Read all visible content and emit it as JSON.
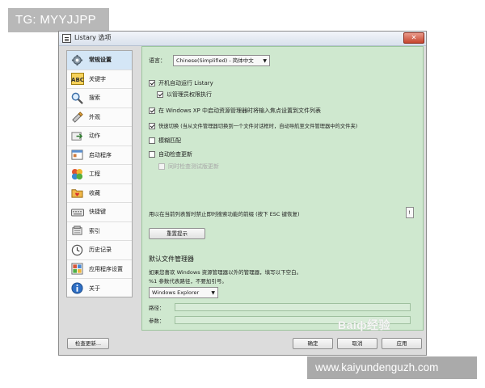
{
  "overlay": {
    "tg_label": "TG: MYYJJPP",
    "url_text": "www.kaiyundenguzh.com",
    "watermark": "Baiф经验"
  },
  "window": {
    "title": "Listary 选项"
  },
  "sidebar": {
    "items": [
      {
        "label": "常规设置",
        "icon": "gear-icon"
      },
      {
        "label": "关键字",
        "icon": "abc-icon"
      },
      {
        "label": "搜索",
        "icon": "magnifier-icon"
      },
      {
        "label": "外观",
        "icon": "paint-icon"
      },
      {
        "label": "动作",
        "icon": "action-icon"
      },
      {
        "label": "启动程序",
        "icon": "launcher-icon"
      },
      {
        "label": "工程",
        "icon": "project-icon"
      },
      {
        "label": "收藏",
        "icon": "folder-heart-icon"
      },
      {
        "label": "快捷键",
        "icon": "keyboard-icon"
      },
      {
        "label": "索引",
        "icon": "index-icon"
      },
      {
        "label": "历史记录",
        "icon": "clock-icon"
      },
      {
        "label": "应用程序设置",
        "icon": "app-settings-icon"
      },
      {
        "label": "关于",
        "icon": "info-icon"
      }
    ]
  },
  "general": {
    "language_label": "语言：",
    "language_value": "Chinese(Simplified) - 简体中文",
    "checkboxes": [
      {
        "label": "开机自动运行 Listary",
        "checked": true,
        "disabled": false
      },
      {
        "label": "以管理员权限执行",
        "checked": true,
        "disabled": false
      },
      {
        "label": "在 Windows XP 中启动资源管理器时将输入焦点设置到文件列表",
        "checked": true,
        "disabled": false
      },
      {
        "label": "快速切换 (当从文件管理器切换到一个文件对话框时，自动导航至文件管理器中的文件夹)",
        "checked": true,
        "disabled": false
      },
      {
        "label": "模糊匹配",
        "checked": false,
        "disabled": false
      },
      {
        "label": "自动检查更新",
        "checked": false,
        "disabled": false
      },
      {
        "label": "同时检查测试版更新",
        "checked": false,
        "disabled": true
      }
    ],
    "shortcut_note": "用以在当前列表暂时禁止即时搜索功能的前缀 (按下 ESC 键恢复)",
    "shortcut_value": "!",
    "reset_button": "重置提示",
    "fm_heading": "默认文件管理器",
    "fm_desc_1": "如果您喜欢 Windows 资源管理器以外的管理器，填写以下空白。",
    "fm_desc_2": "%1 参数代表路径，不要加引号。",
    "fm_select_value": "Windows Explorer",
    "path_label": "路径：",
    "params_label": "参数："
  },
  "footer": {
    "check_updates_button": "检查更新...",
    "ok_button": "确定",
    "cancel_button": "取消",
    "apply_button": "应用"
  }
}
